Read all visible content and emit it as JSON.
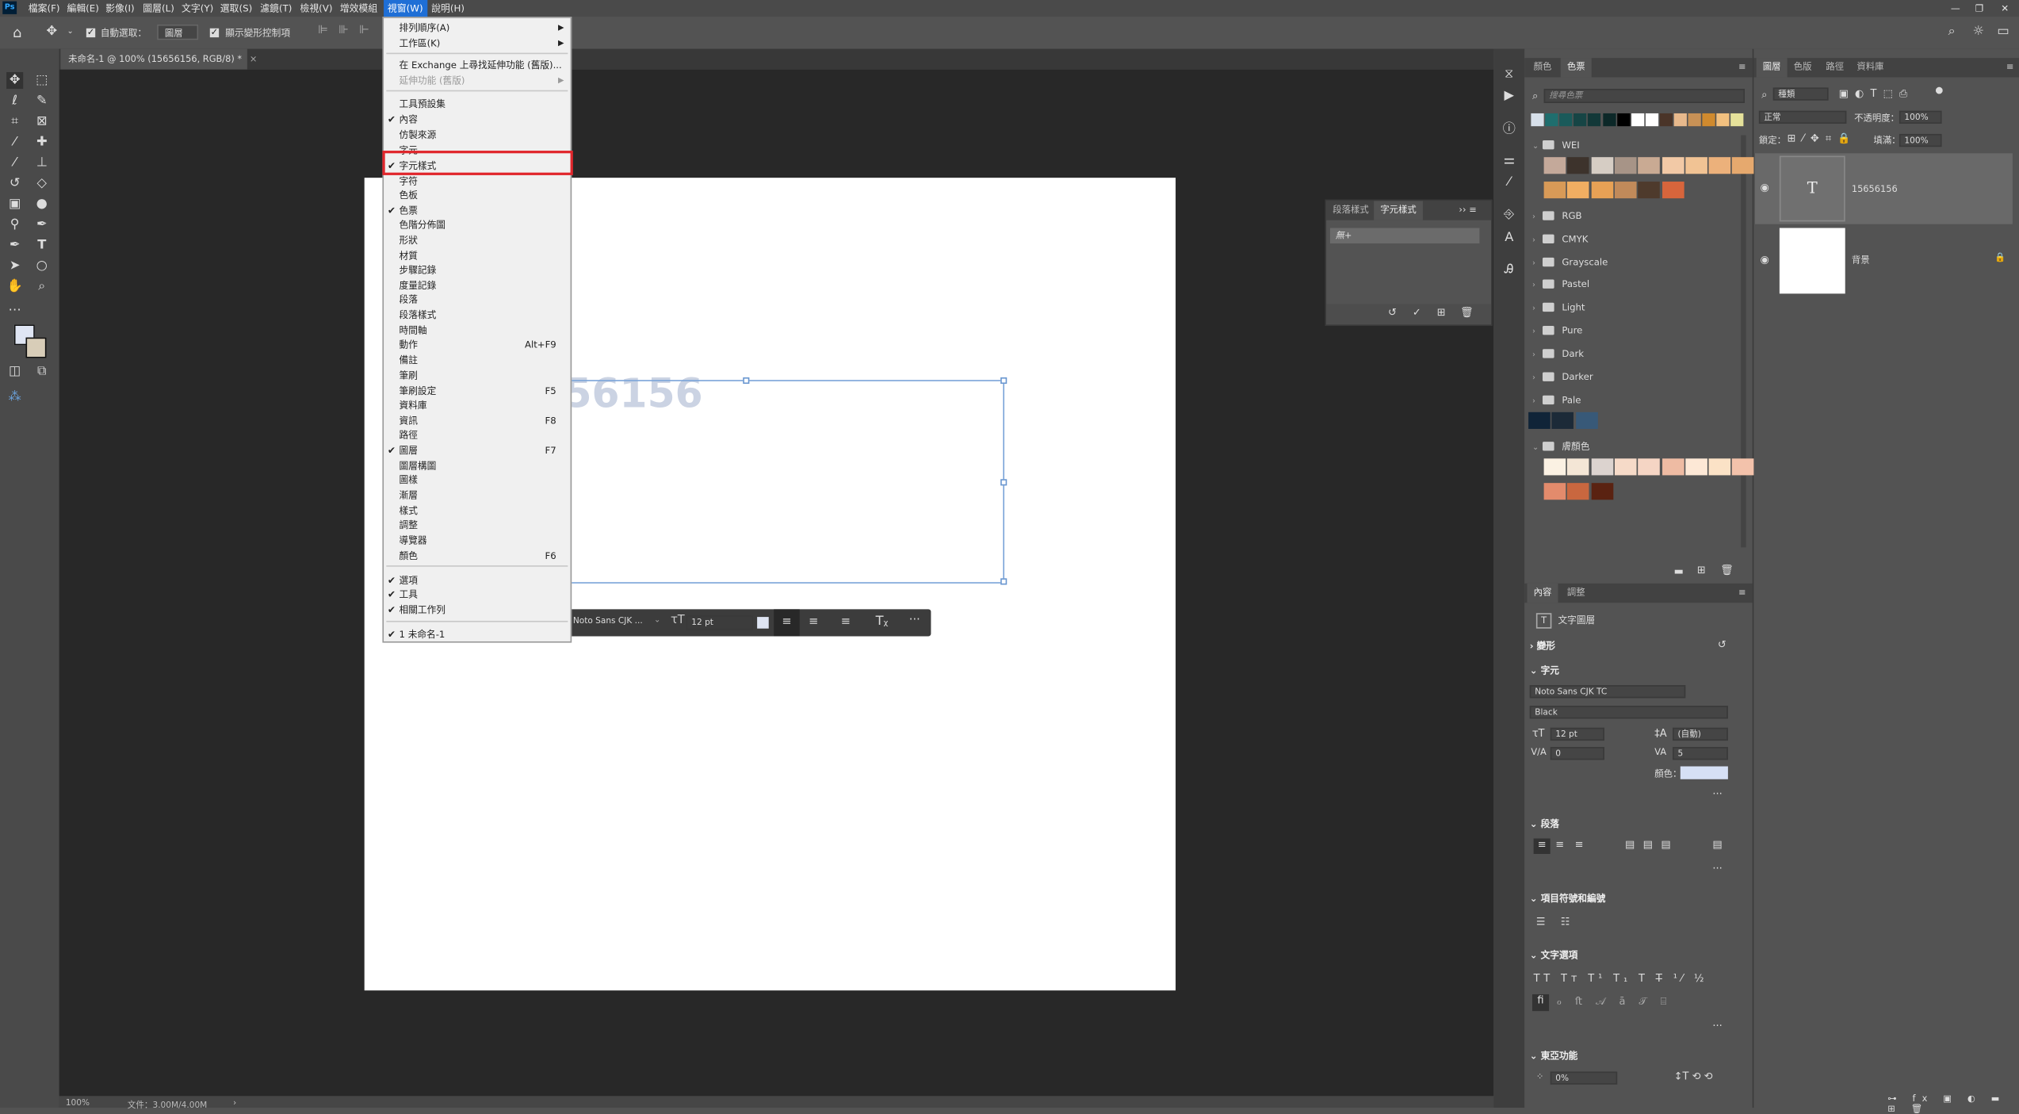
{
  "menubar": {
    "app_icon": "Ps",
    "items": [
      "檔案(F)",
      "編輯(E)",
      "影像(I)",
      "圖層(L)",
      "文字(Y)",
      "選取(S)",
      "濾鏡(T)",
      "檢視(V)",
      "增效模組",
      "視窗(W)",
      "說明(H)"
    ]
  },
  "options": {
    "auto_select_label": "自動選取：",
    "auto_select_value": "圖層",
    "transform_label": "顯示變形控制項"
  },
  "document": {
    "tab_title": "未命名-1 @ 100% (15656156, RGB/8) *",
    "ghost_text": "56156"
  },
  "status": {
    "zoom": "100%",
    "doc": "文件：3.00M/4.00M"
  },
  "context_bar": {
    "font": "Noto Sans CJK ...",
    "size": "12 pt"
  },
  "window_menu": {
    "items": [
      {
        "label": "排列順序(A)",
        "arrow": true
      },
      {
        "label": "工作區(K)",
        "arrow": true
      },
      {
        "label": "在 Exchange 上尋找延伸功能 (舊版)..."
      },
      {
        "label": "延伸功能 (舊版)",
        "arrow": true,
        "disabled": true
      },
      {
        "label": "工具預設集"
      },
      {
        "label": "內容",
        "checked": true
      },
      {
        "label": "仿製來源"
      },
      {
        "label": "字元"
      },
      {
        "label": "字元樣式",
        "checked": true
      },
      {
        "label": "字符"
      },
      {
        "label": "色板"
      },
      {
        "label": "色票",
        "checked": true
      },
      {
        "label": "色階分佈圖"
      },
      {
        "label": "形狀"
      },
      {
        "label": "材質"
      },
      {
        "label": "步驟記錄"
      },
      {
        "label": "度量記錄"
      },
      {
        "label": "段落"
      },
      {
        "label": "段落樣式"
      },
      {
        "label": "時間軸"
      },
      {
        "label": "動作",
        "shortcut": "Alt+F9"
      },
      {
        "label": "備註"
      },
      {
        "label": "筆刷"
      },
      {
        "label": "筆刷設定",
        "shortcut": "F5"
      },
      {
        "label": "資料庫"
      },
      {
        "label": "資訊",
        "shortcut": "F8"
      },
      {
        "label": "路徑"
      },
      {
        "label": "圖層",
        "checked": true,
        "shortcut": "F7"
      },
      {
        "label": "圖層構圖"
      },
      {
        "label": "圖樣"
      },
      {
        "label": "漸層"
      },
      {
        "label": "樣式"
      },
      {
        "label": "調整"
      },
      {
        "label": "導覽器"
      },
      {
        "label": "顏色",
        "shortcut": "F6"
      },
      {
        "label": "選項",
        "checked": true
      },
      {
        "label": "工具",
        "checked": true
      },
      {
        "label": "相關工作列",
        "checked": true
      },
      {
        "label": "1 未命名-1",
        "checked": true
      }
    ]
  },
  "char_styles_panel": {
    "tabs": [
      "段落樣式",
      "字元樣式"
    ],
    "item": "無+"
  },
  "swatches_panel": {
    "tabs": [
      "顏色",
      "色票"
    ],
    "search_placeholder": "搜尋色票",
    "recent_colors": [
      "#d7e0ea",
      "#1f6e6e",
      "#1a5a5a",
      "#164545",
      "#123838",
      "#0c2828",
      "#000000",
      "#ffffff",
      "#ffffff",
      "#4a3428",
      "#e8b98c",
      "#c89156",
      "#d08a2e",
      "#f2c07f",
      "#e5e19a"
    ],
    "groups": [
      {
        "name": "WEI",
        "open": true,
        "colors": [
          "#c4a99a",
          "#3d332c",
          "#d6cdc4",
          "#a79487",
          "#c9aa93",
          "#f2c9a6",
          "#f1c394",
          "#ecb17b",
          "#e6a96e",
          "#d89a57",
          "#f1ae62",
          "#e7a155",
          "#c18a5a",
          "#4e3a2c",
          "#d7653c"
        ]
      },
      {
        "name": "RGB"
      },
      {
        "name": "CMYK"
      },
      {
        "name": "Grayscale"
      },
      {
        "name": "Pastel"
      },
      {
        "name": "Light"
      },
      {
        "name": "Pure"
      },
      {
        "name": "Dark"
      },
      {
        "name": "Darker"
      },
      {
        "name": "Pale"
      },
      {
        "name": "膚顏色",
        "open": true,
        "colors": [
          "#fbf1e3",
          "#f4e6d6",
          "#dcd3cf",
          "#f6dac8",
          "#f5d5c4",
          "#eebba3",
          "#fde8d6",
          "#fbe2c6",
          "#f3c2ab",
          "#e38b6c",
          "#c9673f",
          "#5a2211"
        ]
      }
    ],
    "loose_colors": [
      "#102438",
      "#1c2a38",
      "#385978"
    ]
  },
  "properties_panel": {
    "tabs": [
      "內容",
      "調整"
    ],
    "layer_type": "文字圖層",
    "transform": "變形",
    "character_section": "字元",
    "font": "Noto Sans CJK TC",
    "style": "Black",
    "size": "12 pt",
    "leading": "(自動)",
    "kerning": "0",
    "tracking": "5",
    "color_label": "顏色：",
    "color": "#d6e0f5",
    "paragraph_section": "段落",
    "bullets_section": "項目符號和編號",
    "options_section": "文字選項",
    "typo_section": "東亞功能",
    "tsume": "0%"
  },
  "layers_panel": {
    "tabs": [
      "圖層",
      "色版",
      "路徑",
      "資料庫"
    ],
    "kind": "種類",
    "blend": "正常",
    "opacity_label": "不透明度：",
    "opacity": "100%",
    "lock_label": "鎖定：",
    "fill_label": "填滿：",
    "fill": "100%",
    "layers": [
      {
        "name": "15656156",
        "type": "text",
        "selected": true
      },
      {
        "name": "背景",
        "type": "background"
      }
    ]
  }
}
